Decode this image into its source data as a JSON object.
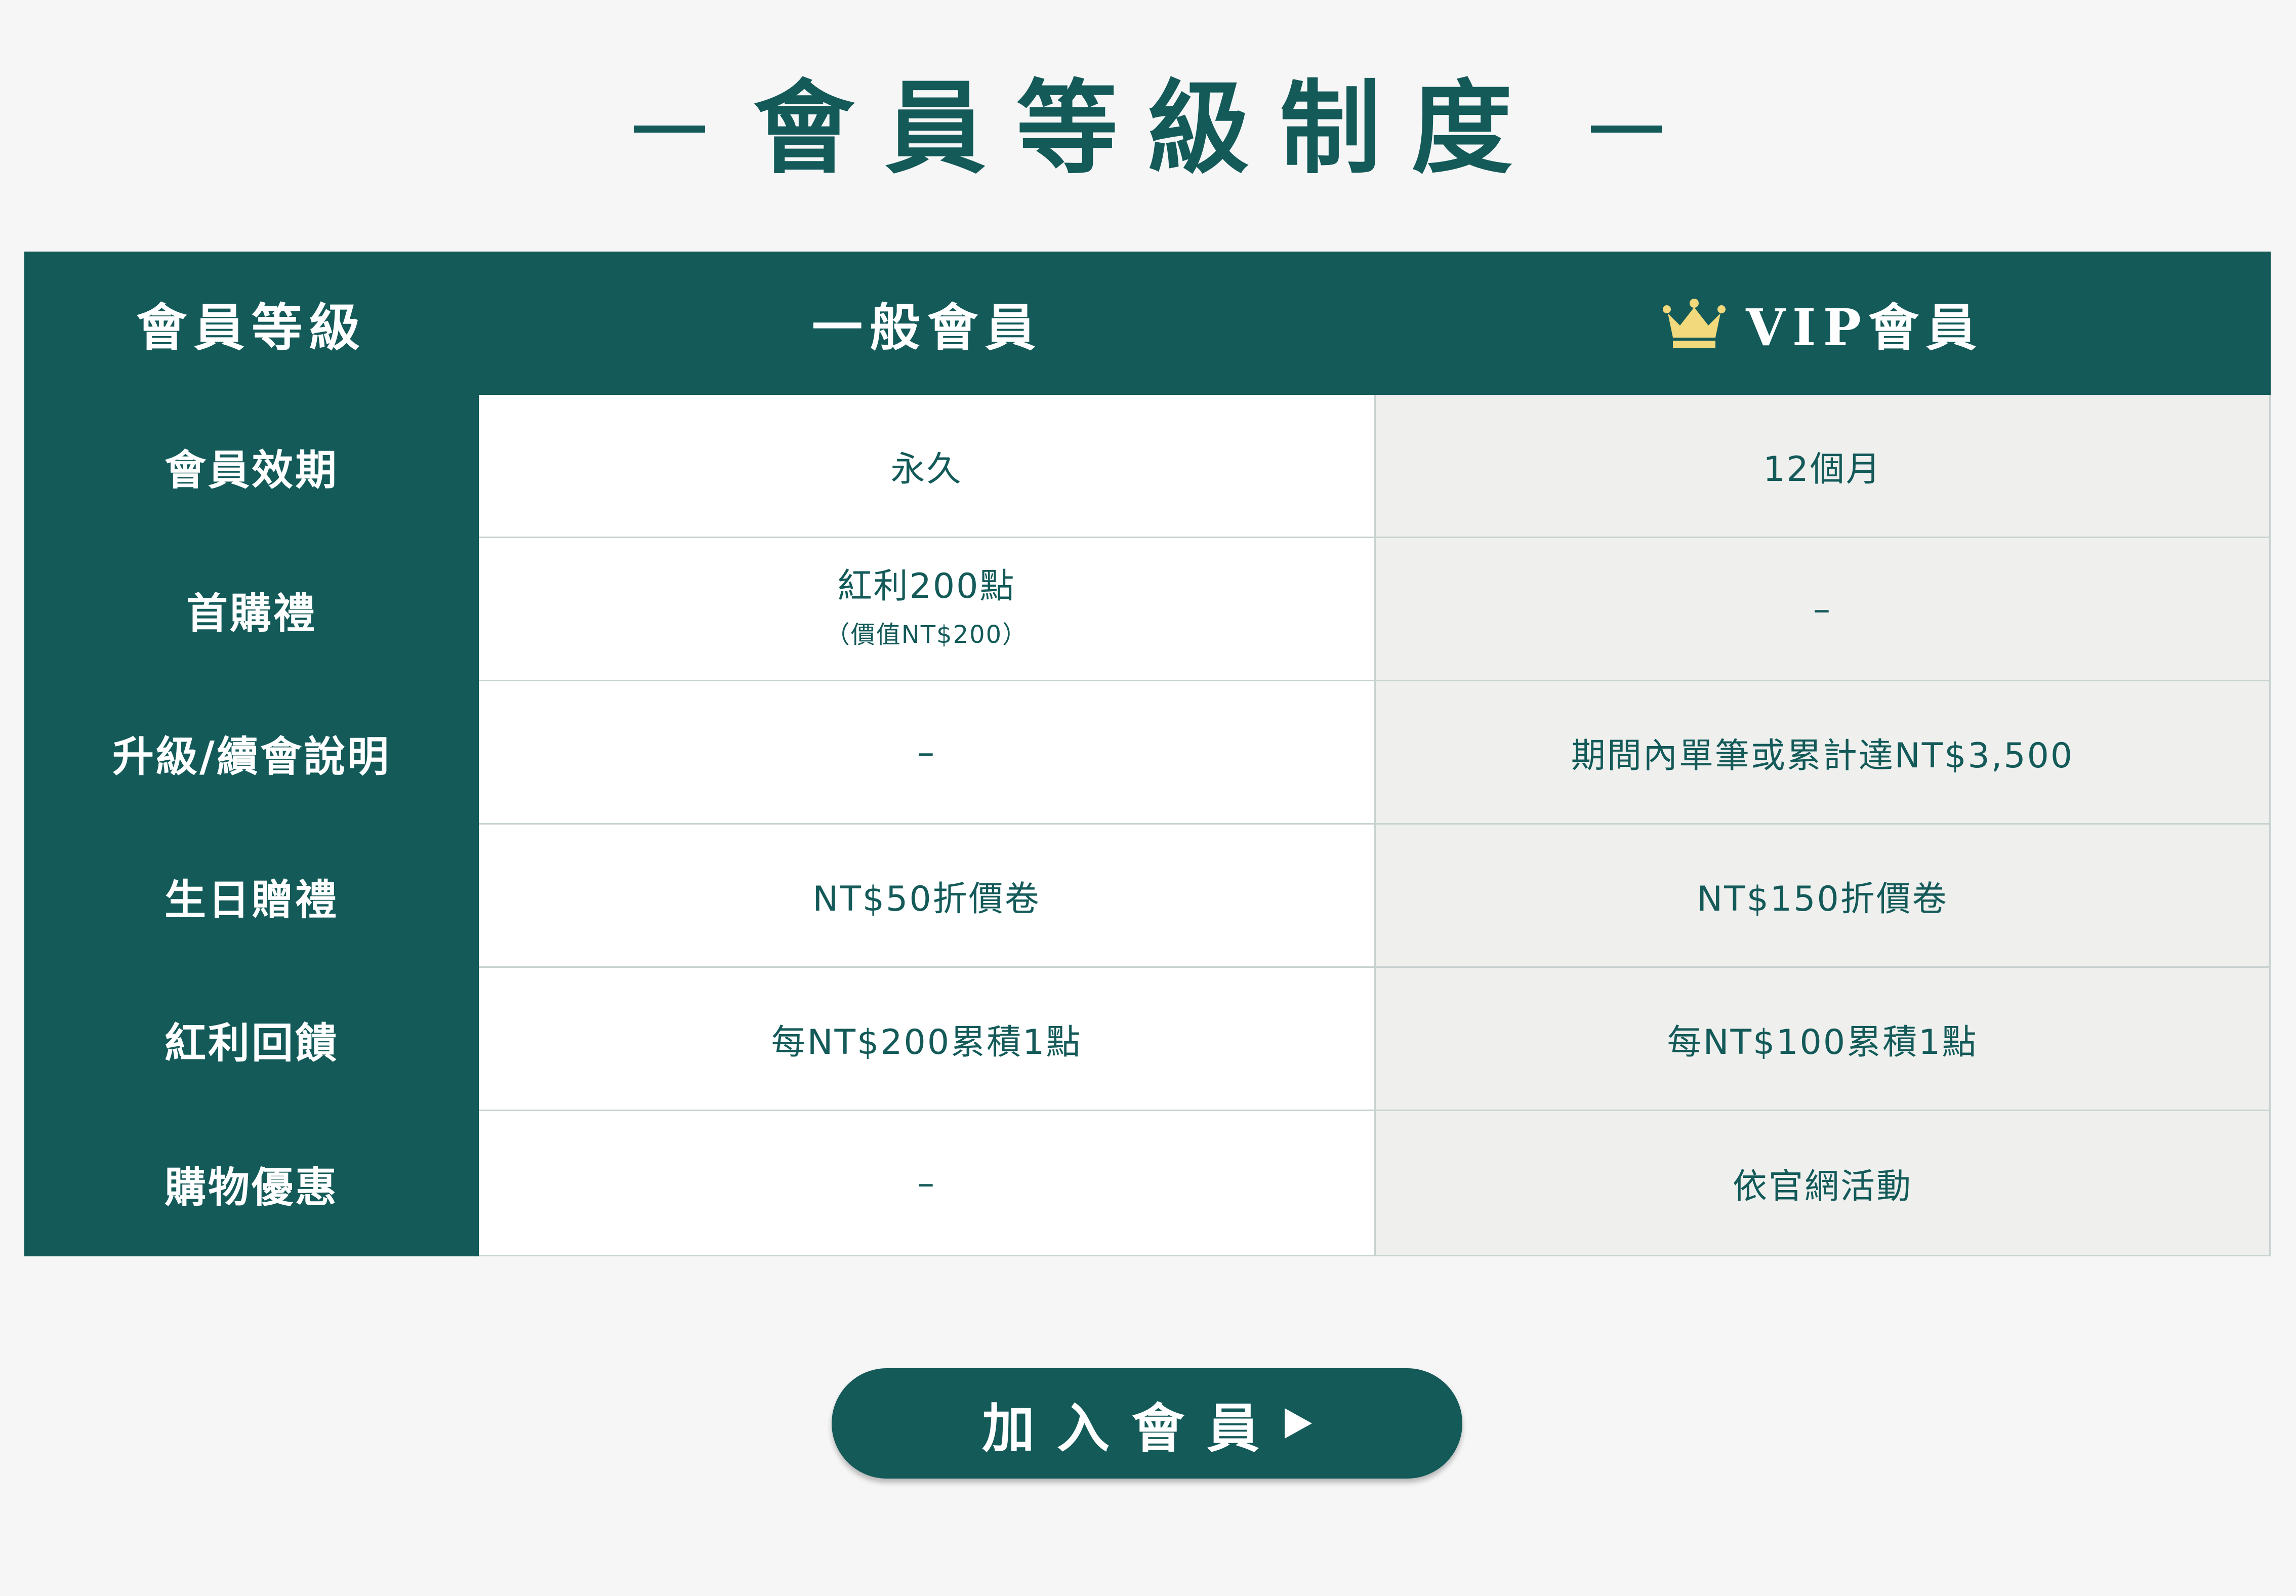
{
  "page": {
    "title": "會員等級制度"
  },
  "colors": {
    "primary": "#135a59",
    "background": "#f6f6f6",
    "vip_column_bg": "#eff0ee",
    "crown": "#f1d97c"
  },
  "table": {
    "header": {
      "label": "會員等級",
      "general": "一般會員",
      "vip": "VIP會員",
      "vip_icon": "crown-icon"
    },
    "rows": [
      {
        "label": "會員效期",
        "general": "永久",
        "vip": "12個月"
      },
      {
        "label": "首購禮",
        "general": "紅利200點",
        "general_note": "（價值NT$200）",
        "vip": "–"
      },
      {
        "label": "升級/續會說明",
        "general": "–",
        "vip": "期間內單筆或累計達NT$3,500"
      },
      {
        "label": "生日贈禮",
        "general": "NT$50折價卷",
        "vip": "NT$150折價卷"
      },
      {
        "label": "紅利回饋",
        "general": "每NT$200累積1點",
        "vip": "每NT$100累積1點"
      },
      {
        "label": "購物優惠",
        "general": "–",
        "vip": "依官網活動"
      }
    ]
  },
  "join_button": {
    "label": "加入會員",
    "icon": "play-icon"
  }
}
